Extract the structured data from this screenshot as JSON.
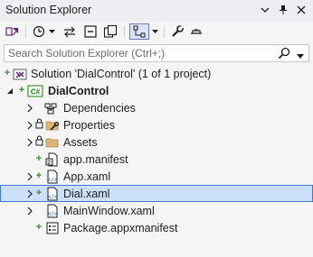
{
  "panel": {
    "title": "Solution Explorer"
  },
  "search": {
    "placeholder": "Search Solution Explorer (Ctrl+;)"
  },
  "tree": [
    {
      "label": "Solution 'DialControl' (1 of 1 project)",
      "name": "tree-item-solution"
    },
    {
      "label": "DialControl",
      "name": "tree-item-project"
    },
    {
      "label": "Dependencies",
      "name": "tree-item-dependencies"
    },
    {
      "label": "Properties",
      "name": "tree-item-properties"
    },
    {
      "label": "Assets",
      "name": "tree-item-assets"
    },
    {
      "label": "app.manifest",
      "name": "tree-item-app-manifest"
    },
    {
      "label": "App.xaml",
      "name": "tree-item-app-xaml"
    },
    {
      "label": "Dial.xaml",
      "name": "tree-item-dial-xaml"
    },
    {
      "label": "MainWindow.xaml",
      "name": "tree-item-mainwindow-xaml"
    },
    {
      "label": "Package.appxmanifest",
      "name": "tree-item-package-appxmanifest"
    }
  ],
  "colors": {
    "selection": "#cce0fd",
    "selection_border": "#3b78d8",
    "csharp": "#178600",
    "vs_purple": "#68217a"
  }
}
